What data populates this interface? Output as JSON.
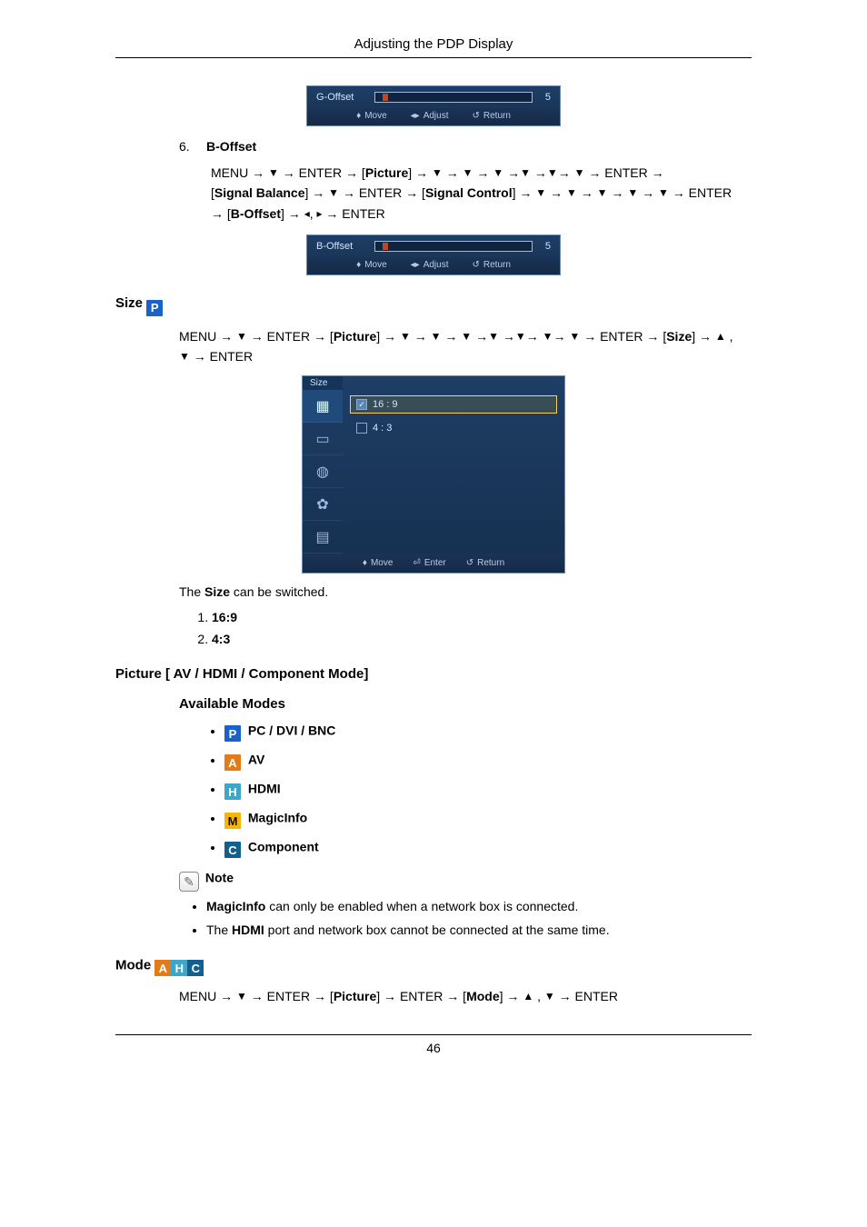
{
  "header": {
    "title": "Adjusting the PDP Display"
  },
  "page_number": "46",
  "g_offset_panel": {
    "label": "G-Offset",
    "value": "5",
    "footer": {
      "move": "Move",
      "adjust": "Adjust",
      "ret": "Return"
    }
  },
  "b_offset": {
    "num": "6.",
    "title": "B-Offset",
    "nav_parts": {
      "menu": "MENU →",
      "enter1": "→ ENTER → [",
      "picture": "Picture",
      "after_picture": "] →",
      "enter2": "→ ENTER →",
      "sb_open": "[",
      "signal_balance": "Signal Balance",
      "sb_close": "] →",
      "enter3": "→ ENTER → [",
      "signal_control": "Signal Control",
      "sc_close": "] →",
      "enter4": "→ ENTER",
      "arrow": "→ [",
      "b_offset_label": "B-Offset",
      "bo_close": "] →",
      "final": "→ ENTER"
    },
    "panel": {
      "label": "B-Offset",
      "value": "5",
      "footer": {
        "move": "Move",
        "adjust": "Adjust",
        "ret": "Return"
      }
    }
  },
  "size_section": {
    "heading": "Size",
    "nav": {
      "menu": "MENU →",
      "enter1": "→ ENTER → [",
      "picture": "Picture",
      "close1": "] →",
      "enter2": "→ ENTER → [",
      "size_label": "Size",
      "close2": "] →",
      "final": "→ ENTER"
    },
    "menu": {
      "tab": "Size",
      "option_16_9": "16 : 9",
      "option_4_3": "4 : 3",
      "footer": {
        "move": "Move",
        "enter": "Enter",
        "ret": "Return"
      }
    },
    "body_pre": "The",
    "body_bold": "Size",
    "body_post": "can be switched.",
    "items": {
      "i1": "16:9",
      "i2": "4:3"
    }
  },
  "picture_av": {
    "heading": "Picture [ AV / HDMI / Component Mode]",
    "available": "Available Modes",
    "modes": {
      "pc": "PC / DVI / BNC",
      "av": "AV",
      "hdmi": "HDMI",
      "magic": "MagicInfo",
      "component": "Component"
    },
    "note_label": "Note",
    "note1_pre": "MagicInfo",
    "note1_post": " can only be enabled when a network box is connected.",
    "note2_pre": "The ",
    "note2_bold": "HDMI",
    "note2_post": " port and network box cannot be connected at the same time."
  },
  "mode_section": {
    "heading": "Mode",
    "nav": {
      "menu": "MENU →",
      "enter1": "→ ENTER → [",
      "picture": "Picture",
      "close1": "] → ENTER → [",
      "mode_label": "Mode",
      "close2": "] →",
      "final": "→ ENTER"
    }
  }
}
